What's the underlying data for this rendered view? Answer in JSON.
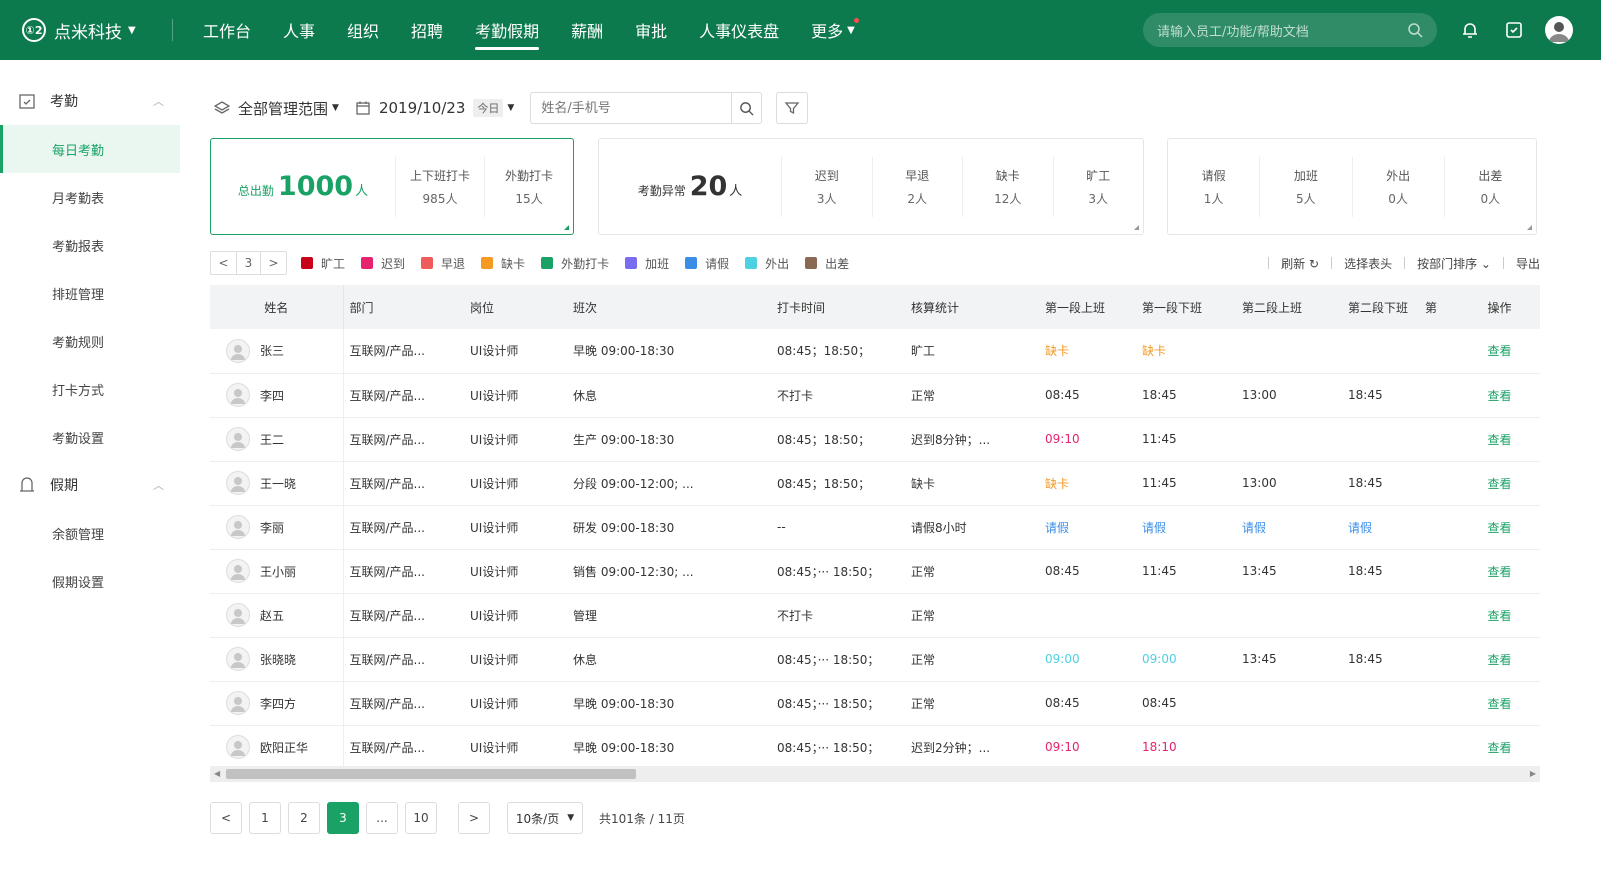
{
  "brand": {
    "logo": "①2",
    "name": "点米科技"
  },
  "nav": [
    {
      "label": "工作台"
    },
    {
      "label": "人事"
    },
    {
      "label": "组织"
    },
    {
      "label": "招聘"
    },
    {
      "label": "考勤假期",
      "active": true
    },
    {
      "label": "薪酬"
    },
    {
      "label": "审批"
    },
    {
      "label": "人事仪表盘"
    },
    {
      "label": "更多"
    }
  ],
  "search": {
    "placeholder": "请输入员工/功能/帮助文档"
  },
  "sidebar": {
    "groups": [
      {
        "label": "考勤",
        "items": [
          "每日考勤",
          "月考勤表",
          "考勤报表",
          "排班管理",
          "考勤规则",
          "打卡方式",
          "考勤设置"
        ]
      },
      {
        "label": "假期",
        "items": [
          "余额管理",
          "假期设置"
        ]
      }
    ]
  },
  "toolbar": {
    "scope": "全部管理范围",
    "date": "2019/10/23",
    "today": "今日",
    "name_placeholder": "姓名/手机号"
  },
  "card1": {
    "label": "总出勤",
    "value": "1000",
    "unit": "人",
    "stats": [
      {
        "t": "上下班打卡",
        "v": "985人"
      },
      {
        "t": "外勤打卡",
        "v": "15人"
      }
    ]
  },
  "card2": {
    "label": "考勤异常",
    "value": "20",
    "unit": "人",
    "stats": [
      {
        "t": "迟到",
        "v": "3人"
      },
      {
        "t": "早退",
        "v": "2人"
      },
      {
        "t": "缺卡",
        "v": "12人"
      },
      {
        "t": "旷工",
        "v": "3人"
      }
    ]
  },
  "card3": {
    "stats": [
      {
        "t": "请假",
        "v": "1人"
      },
      {
        "t": "加班",
        "v": "5人"
      },
      {
        "t": "外出",
        "v": "0人"
      },
      {
        "t": "出差",
        "v": "0人"
      }
    ]
  },
  "mini_pager": {
    "prev": "<",
    "page": "3",
    "next": ">"
  },
  "legend": [
    {
      "label": "旷工",
      "color": "#c9001c"
    },
    {
      "label": "迟到",
      "color": "#e6236f"
    },
    {
      "label": "早退",
      "color": "#f05a5a"
    },
    {
      "label": "缺卡",
      "color": "#f59a23"
    },
    {
      "label": "外勤打卡",
      "color": "#1aa266"
    },
    {
      "label": "加班",
      "color": "#7a6cf0"
    },
    {
      "label": "请假",
      "color": "#3a8ee6"
    },
    {
      "label": "外出",
      "color": "#4dd0e1"
    },
    {
      "label": "出差",
      "color": "#8a6a55"
    }
  ],
  "actions": {
    "refresh": "刷新",
    "columns": "选择表头",
    "sort": "按部门排序",
    "export": "导出"
  },
  "table": {
    "headers": [
      "姓名",
      "部门",
      "岗位",
      "班次",
      "打卡时间",
      "核算统计",
      "第一段上班",
      "第一段下班",
      "第二段上班",
      "第二段下班",
      "第",
      "操作"
    ],
    "rows": [
      {
        "name": "张三",
        "dept": "互联网/产品...",
        "pos": "UI设计师",
        "shift": "早晚 09:00-18:30",
        "punch": "08:45；18:50；",
        "stat": "旷工",
        "s1": "缺卡",
        "s1c": "orange",
        "s2": "缺卡",
        "s2c": "orange",
        "s3": "",
        "s3c": "",
        "s4": "",
        "s4c": "",
        "op": "查看"
      },
      {
        "name": "李四",
        "dept": "互联网/产品...",
        "pos": "UI设计师",
        "shift": "休息",
        "punch": "不打卡",
        "stat": "正常",
        "s1": "08:45",
        "s1c": "",
        "s2": "18:45",
        "s2c": "",
        "s3": "13:00",
        "s3c": "",
        "s4": "18:45",
        "s4c": "",
        "op": "查看"
      },
      {
        "name": "王二",
        "dept": "互联网/产品...",
        "pos": "UI设计师",
        "shift": "生产 09:00-18:30",
        "punch": "08:45；18:50；",
        "stat": "迟到8分钟；...",
        "s1": "09:10",
        "s1c": "pink",
        "s2": "11:45",
        "s2c": "",
        "s3": "",
        "s3c": "",
        "s4": "",
        "s4c": "",
        "op": "查看"
      },
      {
        "name": "王一晓",
        "dept": "互联网/产品...",
        "pos": "UI设计师",
        "shift": "分段 09:00-12:00; ...",
        "punch": "08:45；18:50；",
        "stat": "缺卡",
        "s1": "缺卡",
        "s1c": "orange",
        "s2": "11:45",
        "s2c": "",
        "s3": "13:00",
        "s3c": "",
        "s4": "18:45",
        "s4c": "",
        "op": "查看"
      },
      {
        "name": "李丽",
        "dept": "互联网/产品...",
        "pos": "UI设计师",
        "shift": "研发 09:00-18:30",
        "punch": "--",
        "stat": "请假8小时",
        "s1": "请假",
        "s1c": "blue",
        "s2": "请假",
        "s2c": "blue",
        "s3": "请假",
        "s3c": "blue",
        "s4": "请假",
        "s4c": "blue",
        "op": "查看"
      },
      {
        "name": "王小丽",
        "dept": "互联网/产品...",
        "pos": "UI设计师",
        "shift": "销售 09:00-12:30; ...",
        "punch": "08:45；··· 18:50；",
        "stat": "正常",
        "s1": "08:45",
        "s1c": "",
        "s2": "11:45",
        "s2c": "",
        "s3": "13:45",
        "s3c": "",
        "s4": "18:45",
        "s4c": "",
        "op": "查看"
      },
      {
        "name": "赵五",
        "dept": "互联网/产品...",
        "pos": "UI设计师",
        "shift": "管理",
        "punch": "不打卡",
        "stat": "正常",
        "s1": "",
        "s1c": "",
        "s2": "",
        "s2c": "",
        "s3": "",
        "s3c": "",
        "s4": "",
        "s4c": "",
        "op": "查看"
      },
      {
        "name": "张晓晓",
        "dept": "互联网/产品...",
        "pos": "UI设计师",
        "shift": "休息",
        "punch": "08:45；··· 18:50；",
        "stat": "正常",
        "s1": "09:00",
        "s1c": "cyan",
        "s2": "09:00",
        "s2c": "cyan",
        "s3": "13:45",
        "s3c": "",
        "s4": "18:45",
        "s4c": "",
        "op": "查看"
      },
      {
        "name": "李四方",
        "dept": "互联网/产品...",
        "pos": "UI设计师",
        "shift": "早晚 09:00-18:30",
        "punch": "08:45；··· 18:50；",
        "stat": "正常",
        "s1": "08:45",
        "s1c": "",
        "s2": "08:45",
        "s2c": "",
        "s3": "",
        "s3c": "",
        "s4": "",
        "s4c": "",
        "op": "查看"
      },
      {
        "name": "欧阳正华",
        "dept": "互联网/产品...",
        "pos": "UI设计师",
        "shift": "早晚 09:00-18:30",
        "punch": "08:45；··· 18:50；",
        "stat": "迟到2分钟；...",
        "s1": "09:10",
        "s1c": "pink",
        "s2": "18:10",
        "s2c": "pink",
        "s3": "",
        "s3c": "",
        "s4": "",
        "s4c": "",
        "op": "查看"
      }
    ]
  },
  "pagination": {
    "pages": [
      "1",
      "2",
      "3",
      "...",
      "10"
    ],
    "current": "3",
    "size": "10条/页",
    "total": "共101条 / 11页"
  }
}
